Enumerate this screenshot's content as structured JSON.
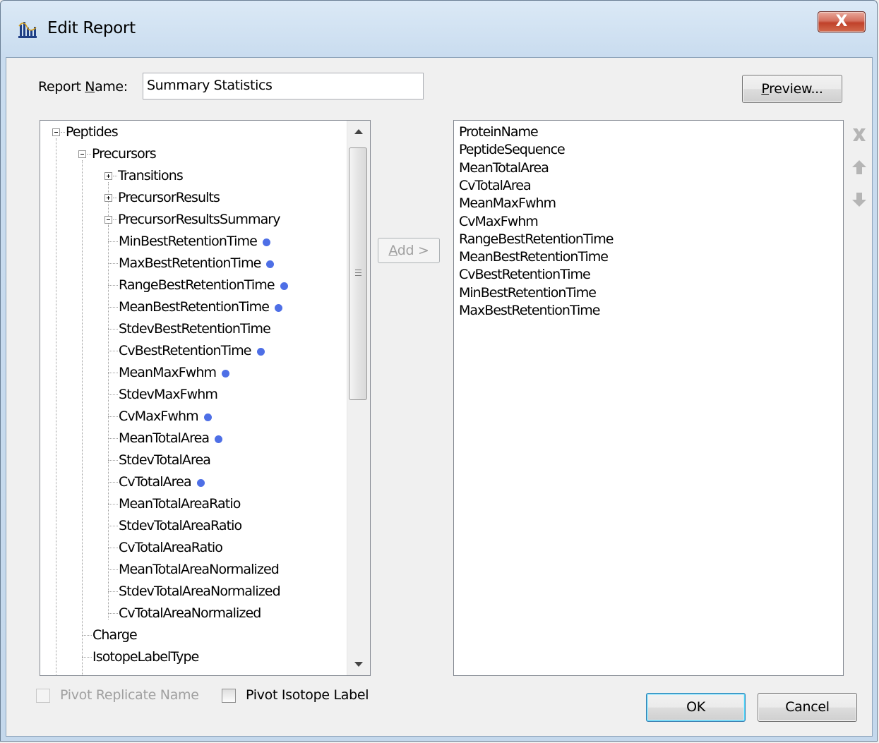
{
  "window": {
    "title": "Edit Report",
    "app_icon": "skyline-chart-icon",
    "close_label": "X"
  },
  "form": {
    "report_name_label": "Report Name:",
    "report_name_value": "Summary Statistics",
    "preview_label": "Preview...",
    "add_label": "Add >",
    "ok_label": "OK",
    "cancel_label": "Cancel",
    "pivot_replicate_label": "Pivot Replicate Name",
    "pivot_replicate_checked": false,
    "pivot_replicate_enabled": false,
    "pivot_isotope_label": "Pivot Isotope Label",
    "pivot_isotope_checked": false
  },
  "tree": {
    "nodes": [
      {
        "label": "Peptides",
        "level": 0,
        "expander": "minus",
        "selected": false
      },
      {
        "label": "Precursors",
        "level": 1,
        "expander": "minus",
        "selected": false
      },
      {
        "label": "Transitions",
        "level": 2,
        "expander": "plus",
        "selected": false
      },
      {
        "label": "PrecursorResults",
        "level": 2,
        "expander": "plus",
        "selected": false
      },
      {
        "label": "PrecursorResultsSummary",
        "level": 2,
        "expander": "minus",
        "selected": false
      },
      {
        "label": "MinBestRetentionTime",
        "level": 3,
        "selected": true
      },
      {
        "label": "MaxBestRetentionTime",
        "level": 3,
        "selected": true
      },
      {
        "label": "RangeBestRetentionTime",
        "level": 3,
        "selected": true
      },
      {
        "label": "MeanBestRetentionTime",
        "level": 3,
        "selected": true
      },
      {
        "label": "StdevBestRetentionTime",
        "level": 3,
        "selected": false
      },
      {
        "label": "CvBestRetentionTime",
        "level": 3,
        "selected": true
      },
      {
        "label": "MeanMaxFwhm",
        "level": 3,
        "selected": true
      },
      {
        "label": "StdevMaxFwhm",
        "level": 3,
        "selected": false
      },
      {
        "label": "CvMaxFwhm",
        "level": 3,
        "selected": true
      },
      {
        "label": "MeanTotalArea",
        "level": 3,
        "selected": true
      },
      {
        "label": "StdevTotalArea",
        "level": 3,
        "selected": false
      },
      {
        "label": "CvTotalArea",
        "level": 3,
        "selected": true
      },
      {
        "label": "MeanTotalAreaRatio",
        "level": 3,
        "selected": false
      },
      {
        "label": "StdevTotalAreaRatio",
        "level": 3,
        "selected": false
      },
      {
        "label": "CvTotalAreaRatio",
        "level": 3,
        "selected": false
      },
      {
        "label": "MeanTotalAreaNormalized",
        "level": 3,
        "selected": false
      },
      {
        "label": "StdevTotalAreaNormalized",
        "level": 3,
        "selected": false
      },
      {
        "label": "CvTotalAreaNormalized",
        "level": 3,
        "selected": false
      },
      {
        "label": "Charge",
        "level": 2,
        "selected": false
      },
      {
        "label": "IsotopeLabelType",
        "level": 2,
        "selected": false
      }
    ],
    "selected_marker_color": "#4e6fe6"
  },
  "columns": {
    "items": [
      "ProteinName",
      "PeptideSequence",
      "MeanTotalArea",
      "CvTotalArea",
      "MeanMaxFwhm",
      "CvMaxFwhm",
      "RangeBestRetentionTime",
      "MeanBestRetentionTime",
      "CvBestRetentionTime",
      "MinBestRetentionTime",
      "MaxBestRetentionTime"
    ],
    "side_icons": [
      "delete-x-icon",
      "move-up-arrow-icon",
      "move-down-arrow-icon"
    ]
  },
  "colors": {
    "close_button": "#c0412a",
    "default_button_border": "#3c7fb1"
  }
}
